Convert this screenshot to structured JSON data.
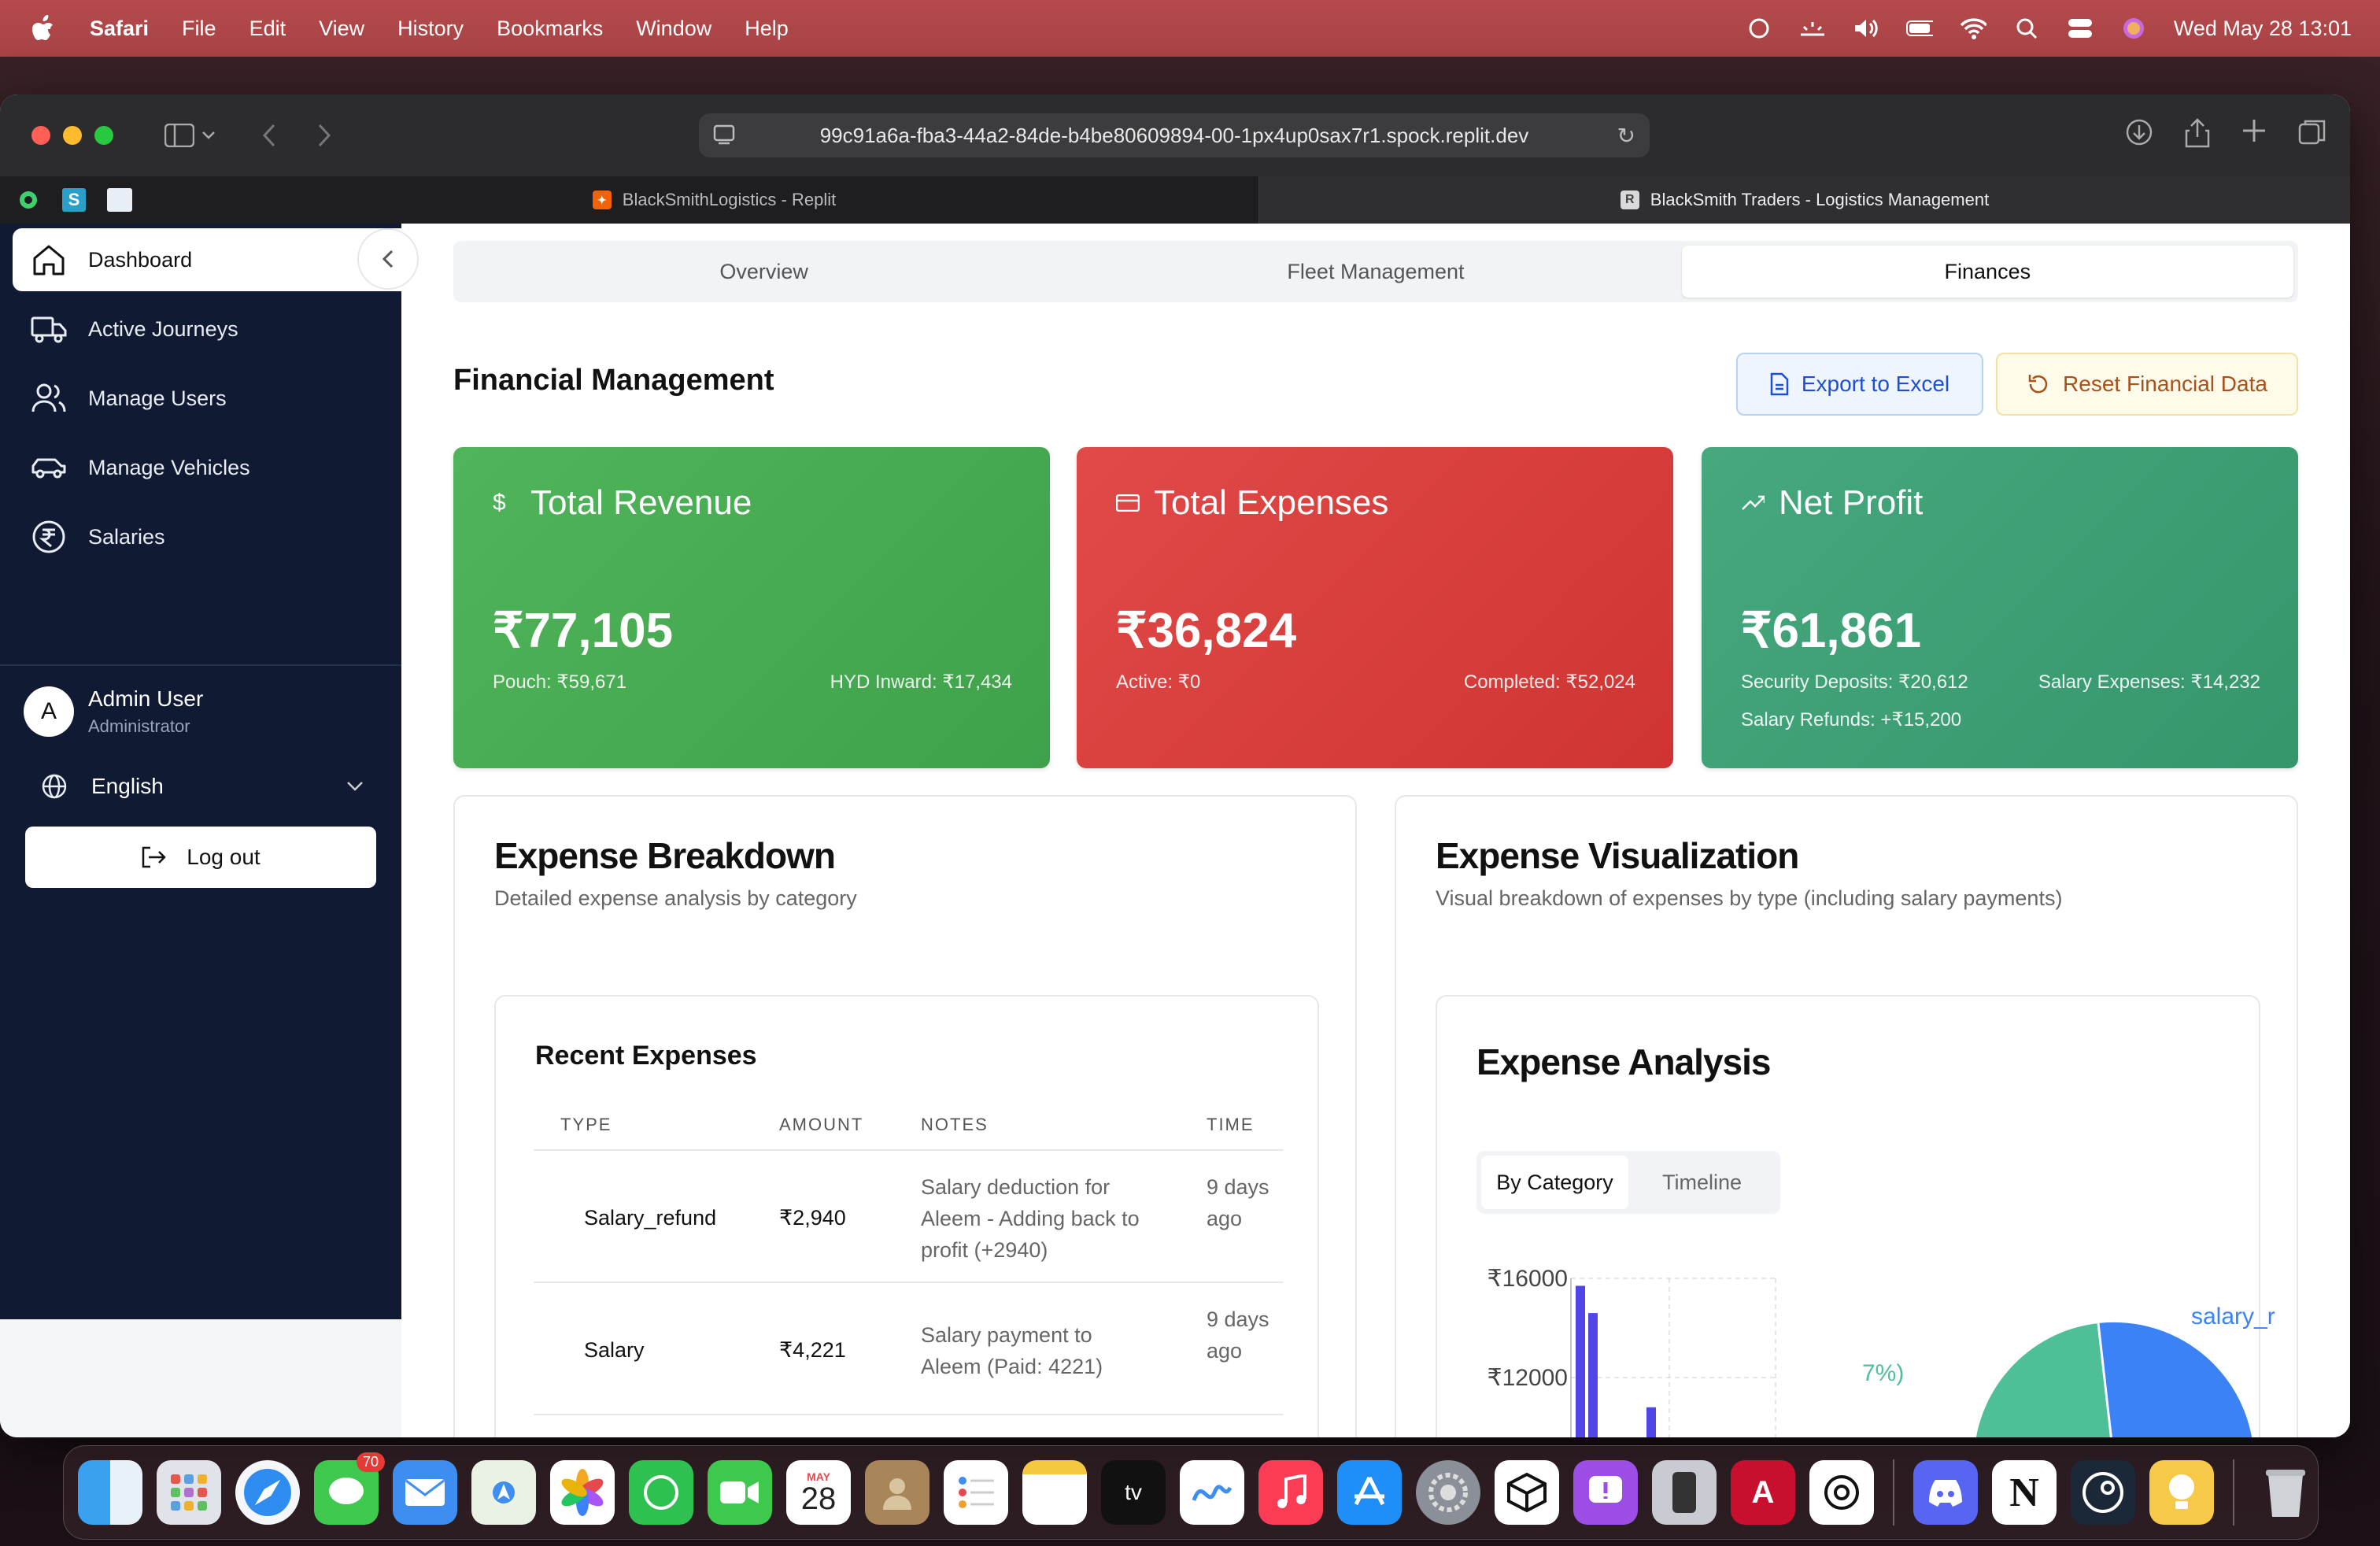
{
  "menubar": {
    "app": "Safari",
    "items": [
      "File",
      "Edit",
      "View",
      "History",
      "Bookmarks",
      "Window",
      "Help"
    ],
    "clock": "Wed May 28  13:01"
  },
  "browser": {
    "url": "99c91a6a-fba3-44a2-84de-b4be80609894-00-1px4up0sax7r1.spock.replit.dev",
    "tabs": [
      {
        "title": "BlackSmithLogistics - Replit"
      },
      {
        "title": "BlackSmith Traders - Logistics Management"
      }
    ]
  },
  "sidebar": {
    "items": [
      {
        "label": "Dashboard"
      },
      {
        "label": "Active Journeys"
      },
      {
        "label": "Manage Users"
      },
      {
        "label": "Manage Vehicles"
      },
      {
        "label": "Salaries"
      }
    ],
    "user": {
      "initial": "A",
      "name": "Admin User",
      "role": "Administrator"
    },
    "language": "English",
    "logout": "Log out"
  },
  "main": {
    "tabs": [
      "Overview",
      "Fleet Management",
      "Finances"
    ],
    "heading": "Financial Management",
    "export_label": "Export to Excel",
    "reset_label": "Reset Financial Data",
    "cards": {
      "revenue": {
        "title": "Total Revenue",
        "value": "₹77,105",
        "left": "Pouch: ₹59,671",
        "right": "HYD Inward: ₹17,434"
      },
      "expenses": {
        "title": "Total Expenses",
        "value": "₹36,824",
        "left": "Active: ₹0",
        "right": "Completed: ₹52,024"
      },
      "profit": {
        "title": "Net Profit",
        "value": "₹61,861",
        "line1_left": "Security Deposits: ₹20,612",
        "line1_right": "Salary Expenses: ₹14,232",
        "line2": "Salary Refunds: +₹15,200"
      }
    },
    "breakdown": {
      "title": "Expense Breakdown",
      "subtitle": "Detailed expense analysis by category",
      "table_title": "Recent Expenses",
      "columns": [
        "TYPE",
        "AMOUNT",
        "NOTES",
        "TIME"
      ],
      "rows": [
        {
          "type": "Salary_refund",
          "amount": "₹2,940",
          "notes": "Salary deduction for Aleem - Adding back to profit (+2940)",
          "time": "9 days ago"
        },
        {
          "type": "Salary",
          "amount": "₹4,221",
          "notes": "Salary payment to Aleem (Paid: 4221)",
          "time": "9 days ago"
        }
      ]
    },
    "visualization": {
      "title": "Expense Visualization",
      "subtitle": "Visual breakdown of expenses by type (including salary payments)",
      "chart_title": "Expense Analysis",
      "tabs": [
        "By Category",
        "Timeline"
      ],
      "pie_label_right": "salary_r",
      "pie_label_left": "7%)"
    }
  },
  "chart_data": {
    "type": "bar",
    "ylabel": "",
    "yticks": [
      "₹16000",
      "₹12000"
    ],
    "ylim": [
      8000,
      16000
    ],
    "series": [
      {
        "values": [
          15700,
          14600,
          10800
        ]
      }
    ]
  },
  "colors": {
    "sidebar_bg": "#101a33",
    "revenue": "#4caf50",
    "expenses": "#dc3b39",
    "profit": "#3fa277",
    "bar": "#4f46e5",
    "pie_blue": "#3b82f6",
    "pie_green": "#4fbf98"
  }
}
